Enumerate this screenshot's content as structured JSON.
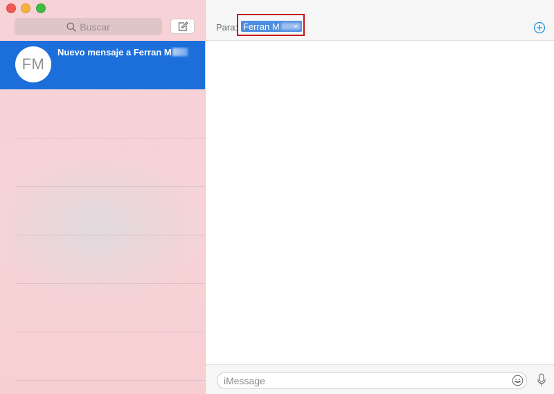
{
  "window": {
    "controls": [
      "close",
      "minimize",
      "zoom"
    ]
  },
  "sidebar": {
    "search": {
      "placeholder": "Buscar",
      "icon": "search-icon"
    },
    "compose_icon": "compose-icon",
    "conversations": [
      {
        "initials": "FM",
        "title": "Nuevo mensaje a Ferran M",
        "selected": true
      }
    ]
  },
  "header": {
    "to_label": "Para:",
    "recipient": "Ferran M",
    "add_icon": "plus-circle-icon"
  },
  "composer": {
    "placeholder": "iMessage",
    "emoji_icon": "emoji-icon",
    "mic_icon": "microphone-icon"
  },
  "colors": {
    "selection": "#1c6fdb",
    "highlight_box": "#c4121a",
    "recipient_chip": "#4d8ee0",
    "accent": "#1a8fe0"
  }
}
